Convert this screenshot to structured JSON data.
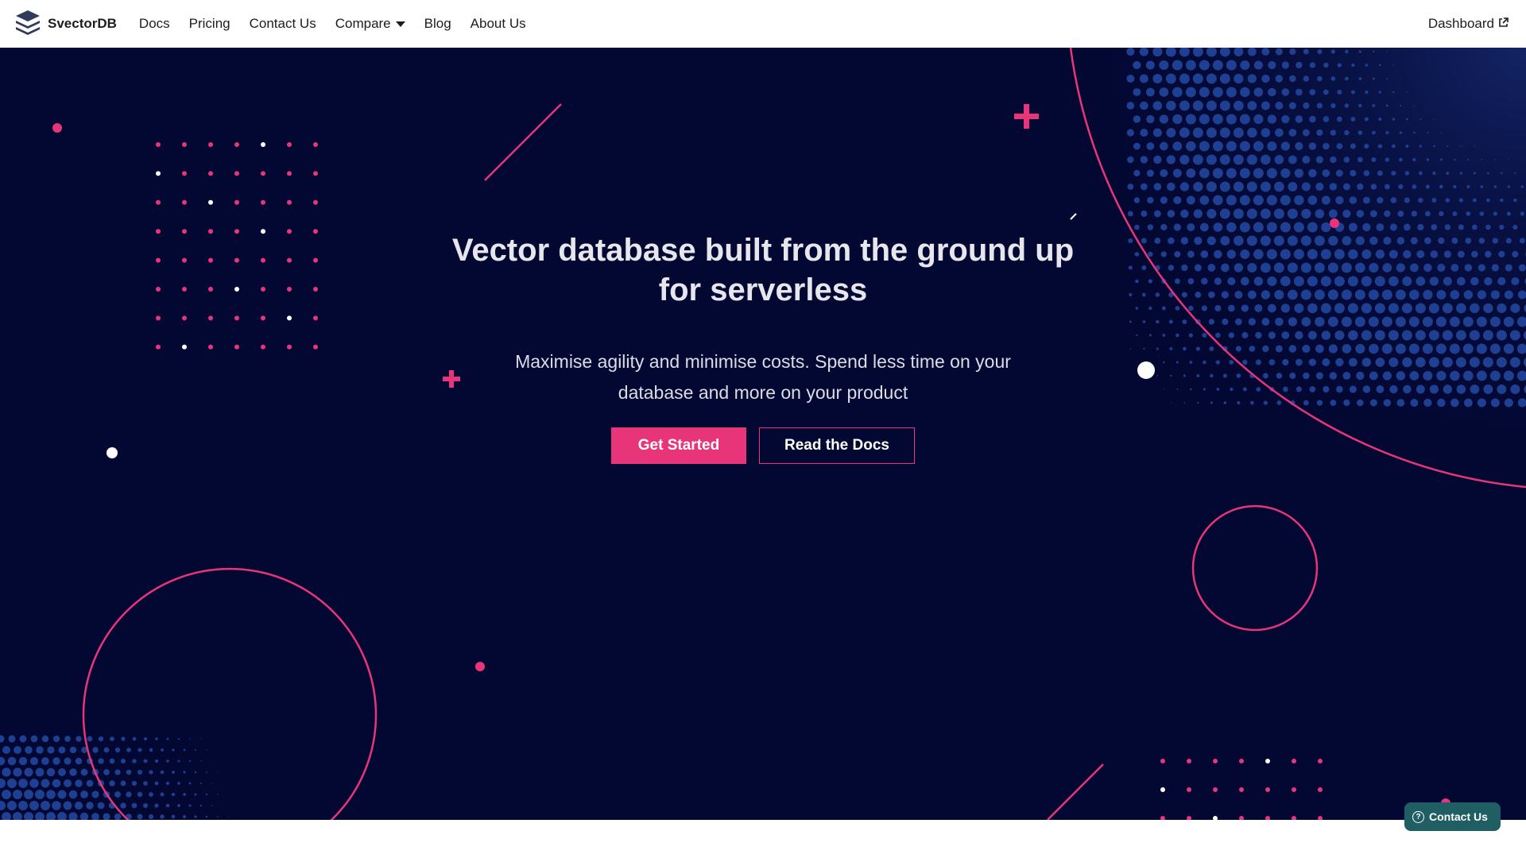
{
  "navbar": {
    "brand": "SvectorDB",
    "links": [
      "Docs",
      "Pricing",
      "Contact Us",
      "Compare",
      "Blog",
      "About Us"
    ],
    "dashboard": "Dashboard"
  },
  "hero": {
    "title": "Vector database built from the ground up for serverless",
    "subtitle": "Maximise agility and minimise costs. Spend less time on your database and more on your product",
    "primary_button": "Get Started",
    "secondary_button": "Read the Docs"
  },
  "widget": {
    "label": "Contact Us",
    "icon": "question-circle-icon"
  },
  "colors": {
    "background": "#030833",
    "accent": "#e8357a",
    "widget": "#1f5e63"
  }
}
